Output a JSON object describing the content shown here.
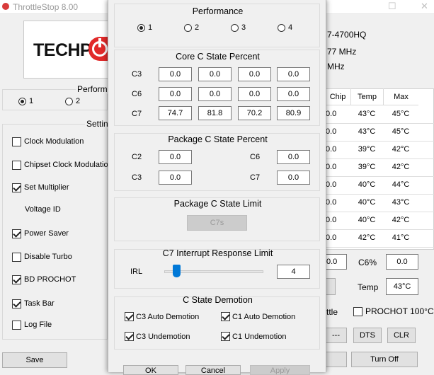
{
  "main_window": {
    "title": "ThrottleStop 8.00",
    "logo_text": "TECHP",
    "cpu_name": "7-4700HQ",
    "freq1": "77 MHz",
    "freq2": "MHz",
    "performance_label": "Perform",
    "radio1": "1",
    "radio2": "2",
    "settings_label": "Settin",
    "options": [
      {
        "label": "Clock Modulation",
        "checked": false
      },
      {
        "label": "Chipset Clock Modulation",
        "checked": false
      },
      {
        "label": "Set Multiplier",
        "checked": true
      },
      {
        "label": "Voltage ID",
        "checked": null
      },
      {
        "label": "Power Saver",
        "checked": true
      },
      {
        "label": "Disable Turbo",
        "checked": false
      },
      {
        "label": "BD PROCHOT",
        "checked": true
      },
      {
        "label": "Task Bar",
        "checked": true
      },
      {
        "label": "Log File",
        "checked": false
      }
    ],
    "save_button": "Save",
    "table": {
      "headers": [
        "Chip",
        "Temp",
        "Max"
      ],
      "rows": [
        [
          "0.0",
          "43°C",
          "45°C"
        ],
        [
          "0.0",
          "43°C",
          "45°C"
        ],
        [
          "0.0",
          "39°C",
          "42°C"
        ],
        [
          "0.0",
          "39°C",
          "42°C"
        ],
        [
          "0.0",
          "40°C",
          "44°C"
        ],
        [
          "0.0",
          "40°C",
          "43°C"
        ],
        [
          "0.0",
          "40°C",
          "42°C"
        ],
        [
          "0.0",
          "42°C",
          "41°C"
        ]
      ]
    },
    "c6_label": "C6%",
    "c6_left_value": "0.0",
    "c6_value": "0.0",
    "temp_label": "Temp",
    "temp_value": "43°C",
    "ttle_label": "ttle",
    "prochot_label": "PROCHOT 100°C",
    "dash_button": "---",
    "dts_button": "DTS",
    "clr_button": "CLR",
    "turnoff_button": "Turn Off"
  },
  "dialog": {
    "performance": {
      "title": "Performance",
      "options": [
        "1",
        "2",
        "3",
        "4"
      ],
      "selected": 0
    },
    "core_c_state": {
      "title": "Core C State Percent",
      "row_labels": [
        "C3",
        "C6",
        "C7"
      ],
      "values": [
        [
          "0.0",
          "0.0",
          "0.0",
          "0.0"
        ],
        [
          "0.0",
          "0.0",
          "0.0",
          "0.0"
        ],
        [
          "74.7",
          "81.8",
          "70.2",
          "80.9"
        ]
      ]
    },
    "package_c_state": {
      "title": "Package C State Percent",
      "c2_label": "C2",
      "c2_value": "0.0",
      "c6_label": "C6",
      "c6_value": "0.0",
      "c3_label": "C3",
      "c3_value": "0.0",
      "c7_label": "C7",
      "c7_value": "0.0"
    },
    "package_limit": {
      "title": "Package C State Limit",
      "value": "C7s"
    },
    "c7_interrupt": {
      "title": "C7 Interrupt Response Limit",
      "irl_label": "IRL",
      "value": "4",
      "slider_fraction": 0.12
    },
    "demotion": {
      "title": "C State Demotion",
      "items": [
        {
          "label": "C3 Auto Demotion",
          "checked": true
        },
        {
          "label": "C1 Auto Demotion",
          "checked": true
        },
        {
          "label": "C3 Undemotion",
          "checked": true
        },
        {
          "label": "C1 Undemotion",
          "checked": true
        }
      ]
    },
    "ok_button": "OK",
    "cancel_button": "Cancel",
    "apply_button": "Apply"
  }
}
